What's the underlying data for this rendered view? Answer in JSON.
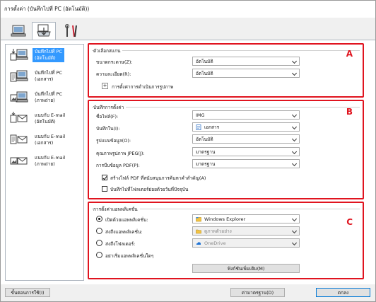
{
  "window": {
    "title": "การตั้งค่า (บันทึกไปที่ PC (อัตโนมัติ))"
  },
  "tabs": [
    {
      "name": "scan-from-computer-tab",
      "icon": "computer-icon"
    },
    {
      "name": "scan-from-operation-panel-tab",
      "icon": "scanner-icon"
    },
    {
      "name": "general-settings-tab",
      "icon": "tools-icon"
    }
  ],
  "sidebar": {
    "items": [
      {
        "label": "บันทึกไปที่ PC\n(อัตโนมัติ)",
        "icon": "save-auto-icon"
      },
      {
        "label": "บันทึกไปที่ PC\n(เอกสาร)",
        "icon": "save-document-icon"
      },
      {
        "label": "บันทึกไปที่ PC\n(ภาพถ่าย)",
        "icon": "save-photo-icon"
      },
      {
        "label": "แนบกับ E-mail\n(อัตโนมัติ)",
        "icon": "email-auto-icon"
      },
      {
        "label": "แนบกับ E-mail\n(เอกสาร)",
        "icon": "email-document-icon"
      },
      {
        "label": "แนบกับ E-mail\n(ภาพถ่าย)",
        "icon": "email-photo-icon"
      }
    ]
  },
  "section_a": {
    "badge": "A",
    "title": "ตัวเลือกสแกน",
    "paper_size_label": "ขนาดกระดาษ(Z):",
    "paper_size_value": "อัตโนมัติ",
    "resolution_label": "ความละเอียด(R):",
    "resolution_value": "อัตโนมัติ",
    "image_processing_label": "การตั้งค่าการดำเนินการรูปภาพ",
    "plus": "+"
  },
  "section_b": {
    "badge": "B",
    "title": "บันทึกการตั้งค่า",
    "file_name_label": "ชื่อไฟล์(F):",
    "file_name_value": "IMG",
    "save_in_label": "บันทึกใน(I):",
    "save_in_value": "เอกสาร",
    "data_format_label": "รูปแบบข้อมูล(O):",
    "data_format_value": "อัตโนมัติ",
    "jpeg_quality_label": "คุณภาพรูปภาพ JPEG(J):",
    "jpeg_quality_value": "มาตรฐาน",
    "pdf_compression_label": "การบีบข้อมูล PDF(P):",
    "pdf_compression_value": "มาตรฐาน",
    "keyword_pdf_label": "สร้างไฟล์ PDF ที่สนับสนุนการค้นหาคำสำคัญ(A)",
    "subfolder_label": "บันทึกไปที่โฟลเดอร์ย่อยด้วยวันที่ปัจจุบัน"
  },
  "section_c": {
    "badge": "C",
    "title": "การตั้งค่าแอพพลิเคชั่น",
    "open_app_label": "เปิดด้วยแอพพลิเคชั่น:",
    "open_app_value": "Windows Explorer",
    "send_app_label": "ส่งถึงแอพพลิเคชั่น:",
    "send_app_value": "ดูภาพตัวอย่าง",
    "send_folder_label": "ส่งถึงโฟลเดอร์:",
    "send_folder_value": "OneDrive",
    "no_app_label": "อย่าเริ่มแอพพลิเคชั่นใดๆ",
    "more_functions_label": "ฟังก์ชันเพิ่มเติม(M)"
  },
  "bottom": {
    "instructions_label": "ขั้นตอนการใช้(I)",
    "defaults_label": "ค่ามาตรฐาน(D)",
    "ok_label": "ตกลง"
  },
  "colors": {
    "highlight": "#e0141f",
    "selection": "#3399ff",
    "bg": "#f0f0f0"
  }
}
